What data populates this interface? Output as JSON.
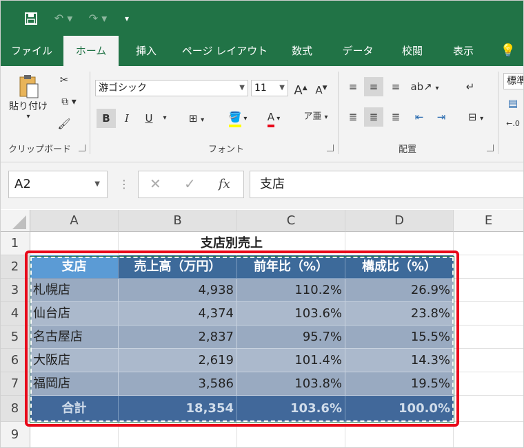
{
  "qat": {
    "save_icon": "save-icon",
    "undo_icon": "undo-icon",
    "redo_icon": "redo-icon",
    "customize_icon": "customize-icon"
  },
  "tabs": [
    "ファイル",
    "ホーム",
    "挿入",
    "ページ レイアウト",
    "数式",
    "データ",
    "校閲",
    "表示"
  ],
  "active_tab": "ホーム",
  "ribbon": {
    "clipboard": {
      "paste_label": "貼り付け",
      "group_label": "クリップボード"
    },
    "font": {
      "font_name": "游ゴシック",
      "font_size": "11",
      "group_label": "フォント",
      "bold": "B",
      "italic": "I",
      "underline": "U",
      "font_color": "#e8081a",
      "fill_color": "#ffff00"
    },
    "alignment": {
      "group_label": "配置"
    },
    "number": {
      "format_label": "標準"
    }
  },
  "formula_bar": {
    "name_box": "A2",
    "fx_label": "fx",
    "content": "支店"
  },
  "columns": [
    "A",
    "B",
    "C",
    "D",
    "E"
  ],
  "rows": [
    "1",
    "2",
    "3",
    "4",
    "5",
    "6",
    "7",
    "8",
    "9"
  ],
  "sheet": {
    "title": "支店別売上",
    "headers": [
      "支店",
      "売上高（万円）",
      "前年比（%）",
      "構成比（%）"
    ],
    "data": [
      [
        "札幌店",
        "4,938",
        "110.2%",
        "26.9%"
      ],
      [
        "仙台店",
        "4,374",
        "103.6%",
        "23.8%"
      ],
      [
        "名古屋店",
        "2,837",
        "95.7%",
        "15.5%"
      ],
      [
        "大阪店",
        "2,619",
        "101.4%",
        "14.3%"
      ],
      [
        "福岡店",
        "3,586",
        "103.8%",
        "19.5%"
      ]
    ],
    "total": [
      "合計",
      "18,354",
      "103.6%",
      "100.0%"
    ]
  },
  "colors": {
    "excel_green": "#217346",
    "header_blue": "#3d6a9a",
    "highlight_red": "#e8081a"
  }
}
